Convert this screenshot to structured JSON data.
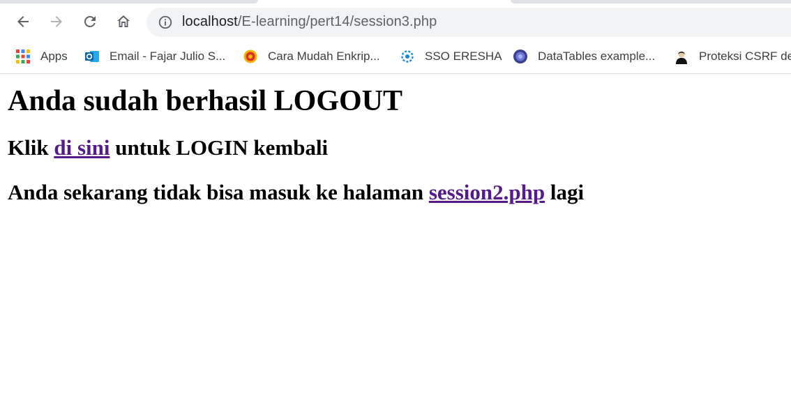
{
  "browser": {
    "url_host": "localhost",
    "url_path": "/E-learning/pert14/session3.php"
  },
  "bookmarks": [
    {
      "label": "Apps",
      "icon": "apps-grid-icon"
    },
    {
      "label": "Email - Fajar Julio S...",
      "icon": "outlook-icon"
    },
    {
      "label": "Cara Mudah Enkrip...",
      "icon": "badge-icon"
    },
    {
      "label": "SSO ERESHA",
      "icon": "sso-gear-icon"
    },
    {
      "label": "DataTables example...",
      "icon": "datatables-icon"
    },
    {
      "label": "Proteksi CSRF de",
      "icon": "avatar-icon"
    }
  ],
  "page": {
    "heading": "Anda sudah berhasil LOGOUT",
    "line1_prefix": "Klik ",
    "line1_link": "di sini",
    "line1_suffix": " untuk LOGIN kembali",
    "line2_prefix": "Anda sekarang tidak bisa masuk ke halaman ",
    "line2_link": "session2.php",
    "line2_suffix": " lagi"
  },
  "colors": {
    "link_visited": "#551a8b",
    "omnibox_bg": "#f1f3f4",
    "chrome_icon": "#5f6368"
  }
}
